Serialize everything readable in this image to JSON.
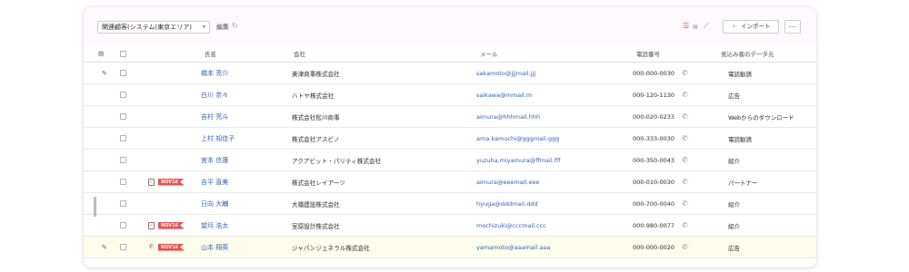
{
  "toolbar": {
    "view_select": "関連顧客(システム(東京エリア)",
    "edit_label": "編集",
    "import_label": "インポート",
    "more_label": "…"
  },
  "columns": {
    "name": "氏名",
    "company": "会社",
    "email": "メール",
    "phone": "電話番号",
    "source": "見込み客のデータ元"
  },
  "tag_label": "NOV16",
  "rows": [
    {
      "name": "橋本 亮介",
      "company": "美津商事株式会社",
      "email": "sakamoto@jjjmail.jjj",
      "phone": "000-000-0030",
      "source": "電話勧誘",
      "edit": true,
      "highlight": false,
      "flag": ""
    },
    {
      "name": "白川 奈々",
      "company": "ハトヤ株式会社",
      "email": "saikawa@mmail.m",
      "phone": "000-120-1130",
      "source": "広告",
      "edit": false,
      "highlight": false,
      "flag": ""
    },
    {
      "name": "吉村 亮斗",
      "company": "株式会社松川商事",
      "email": "aimura@hhhmail.hhh",
      "phone": "000-020-0233",
      "source": "Webからのダウンロード",
      "edit": false,
      "highlight": false,
      "flag": ""
    },
    {
      "name": "上村 知佳子",
      "company": "株式会社アスビノ",
      "email": "ama.kamuchi@gggmail.ggg",
      "phone": "000-333-0030",
      "source": "電話勧誘",
      "edit": false,
      "highlight": false,
      "flag": ""
    },
    {
      "name": "宮本 信蓮",
      "company": "アクアビット・パリティ株式会社",
      "email": "yuzuha.miyamura@ffmail.fff",
      "phone": "000-350-0043",
      "source": "紹介",
      "edit": false,
      "highlight": false,
      "flag": ""
    },
    {
      "name": "吉平 直美",
      "company": "株式会社レイアーツ",
      "email": "aimura@eeemail.eee",
      "phone": "000-010-0030",
      "source": "パートナー",
      "edit": false,
      "highlight": false,
      "flag": "task"
    },
    {
      "name": "日向 大輔",
      "company": "大橋建設株式会社",
      "email": "hyuga@dddmail.ddd",
      "phone": "000-700-0040",
      "source": "紹介",
      "edit": false,
      "highlight": false,
      "flag": ""
    },
    {
      "name": "望月 浩太",
      "company": "室原設計株式会社",
      "email": "mochizuki@cccmail.ccc",
      "phone": "000-980-0077",
      "source": "紹介",
      "edit": false,
      "highlight": false,
      "flag": "task"
    },
    {
      "name": "山本 翔英",
      "company": "ジャパンジェネラル株式会社",
      "email": "yamamoto@aaamail.aaa",
      "phone": "000-000-0020",
      "source": "広告",
      "edit": true,
      "highlight": true,
      "flag": "call"
    }
  ]
}
